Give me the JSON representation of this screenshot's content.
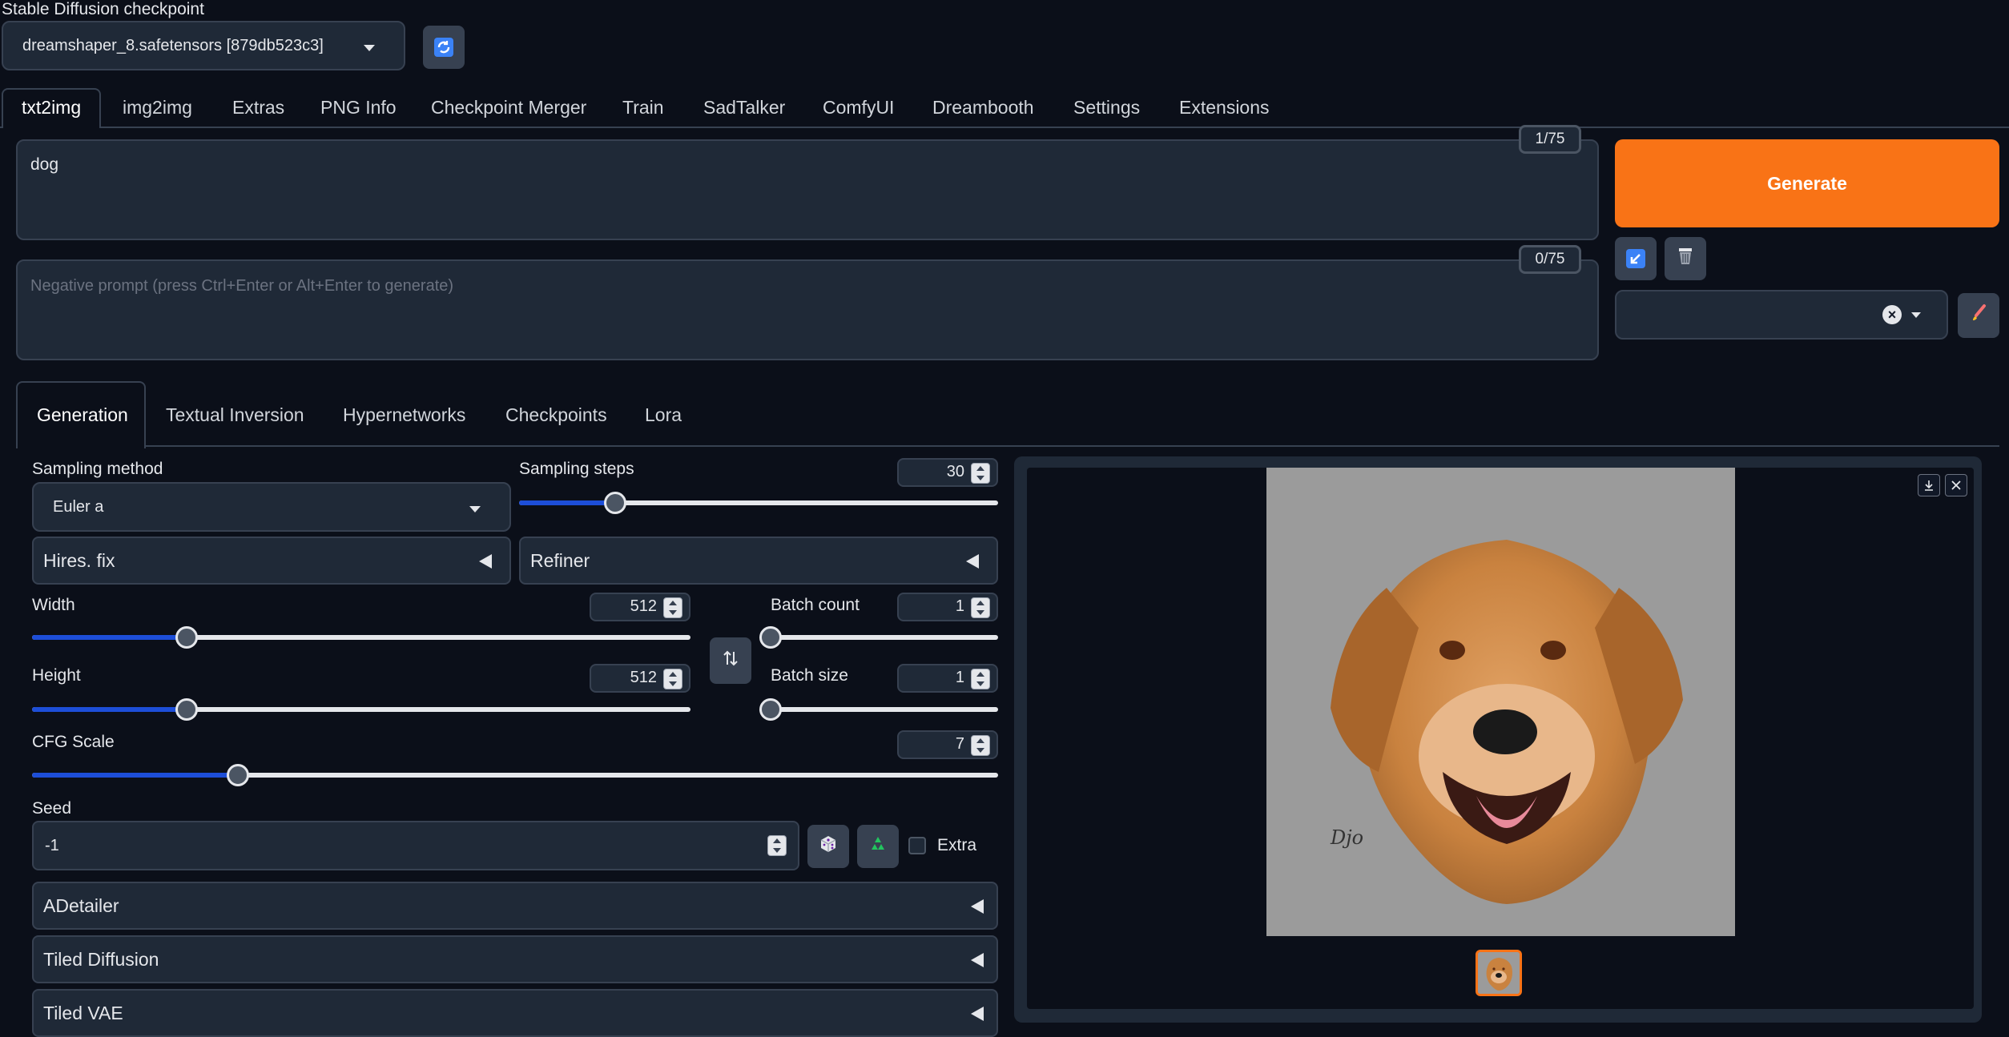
{
  "checkpoint": {
    "label": "Stable Diffusion checkpoint",
    "selected": "dreamshaper_8.safetensors [879db523c3]"
  },
  "tabs": [
    "txt2img",
    "img2img",
    "Extras",
    "PNG Info",
    "Checkpoint Merger",
    "Train",
    "SadTalker",
    "ComfyUI",
    "Dreambooth",
    "Settings",
    "Extensions"
  ],
  "prompt": {
    "value": "dog",
    "token_count": "1/75"
  },
  "negative_prompt": {
    "placeholder": "Negative prompt (press Ctrl+Enter or Alt+Enter to generate)",
    "token_count": "0/75"
  },
  "generate_label": "Generate",
  "subtabs": [
    "Generation",
    "Textual Inversion",
    "Hypernetworks",
    "Checkpoints",
    "Lora"
  ],
  "sampling": {
    "method_label": "Sampling method",
    "method_value": "Euler a",
    "steps_label": "Sampling steps",
    "steps_value": "30",
    "steps_fraction": 0.2
  },
  "hires_fix_label": "Hires. fix",
  "refiner_label": "Refiner",
  "width": {
    "label": "Width",
    "value": "512",
    "fraction": 0.235
  },
  "height": {
    "label": "Height",
    "value": "512",
    "fraction": 0.235
  },
  "batch_count": {
    "label": "Batch count",
    "value": "1",
    "fraction": 0
  },
  "batch_size": {
    "label": "Batch size",
    "value": "1",
    "fraction": 0
  },
  "cfg": {
    "label": "CFG Scale",
    "value": "7",
    "fraction": 0.213
  },
  "seed": {
    "label": "Seed",
    "value": "-1",
    "extra_label": "Extra"
  },
  "accordions": [
    "ADetailer",
    "Tiled Diffusion",
    "Tiled VAE"
  ],
  "output": {
    "signature_text": "Djo"
  },
  "colors": {
    "background": "#0b0f19",
    "panel": "#1f2937",
    "accent_orange": "#f97316",
    "slider_fill": "#1d4ed8"
  }
}
